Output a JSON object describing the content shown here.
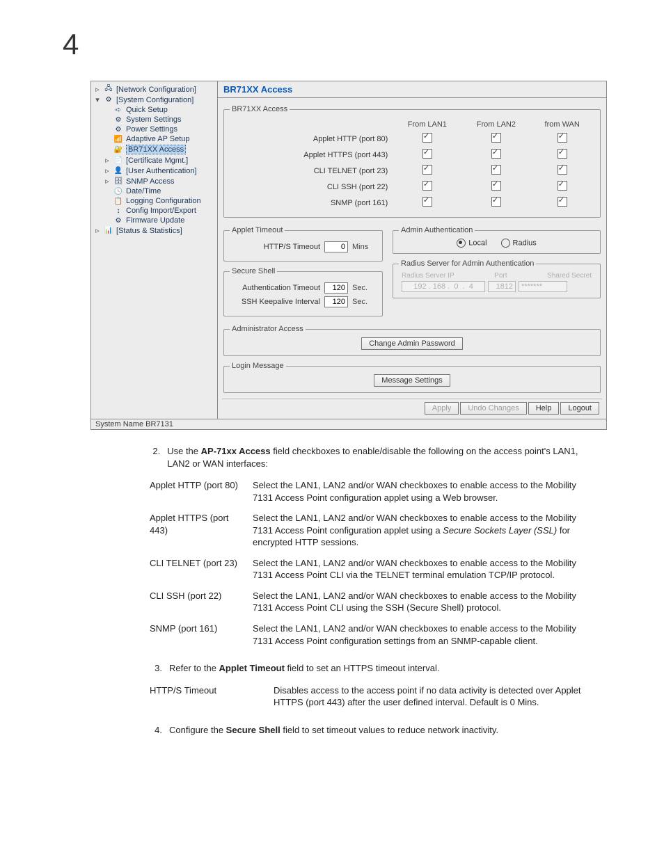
{
  "page_number": "4",
  "screenshot": {
    "tree": {
      "network_config": "[Network Configuration]",
      "system_config": "[System Configuration]",
      "quick_setup": "Quick Setup",
      "system_settings": "System Settings",
      "power_settings": "Power Settings",
      "adaptive_ap_setup": "Adaptive AP Setup",
      "br71xx_access": "BR71XX Access",
      "certificate_mgmt": "[Certificate Mgmt.]",
      "user_auth": "[User Authentication]",
      "snmp_access": "SNMP Access",
      "date_time": "Date/Time",
      "logging_config": "Logging Configuration",
      "config_import_export": "Config Import/Export",
      "firmware_update": "Firmware Update",
      "status_stats": "[Status & Statistics]"
    },
    "content": {
      "title": "BR71XX Access",
      "access_legend": "BR71XX Access",
      "access_cols": {
        "lan1": "From LAN1",
        "lan2": "From LAN2",
        "wan": "from WAN"
      },
      "access_rows": {
        "http": "Applet HTTP (port 80)",
        "https": "Applet HTTPS (port 443)",
        "telnet": "CLI TELNET (port 23)",
        "ssh": "CLI SSH (port 22)",
        "snmp": "SNMP (port 161)"
      },
      "applet_timeout_legend": "Applet Timeout",
      "https_timeout_label": "HTTP/S Timeout",
      "https_timeout_value": "0",
      "https_timeout_unit": "Mins",
      "secure_shell_legend": "Secure Shell",
      "auth_timeout_label": "Authentication Timeout",
      "auth_timeout_value": "120",
      "auth_timeout_unit": "Sec.",
      "ssh_keepalive_label": "SSH Keepalive Interval",
      "ssh_keepalive_value": "120",
      "ssh_keepalive_unit": "Sec.",
      "admin_auth_legend": "Admin Authentication",
      "admin_auth_local": "Local",
      "admin_auth_radius": "Radius",
      "radius_legend": "Radius Server for Admin Authentication",
      "radius_server_ip": "Radius Server IP",
      "radius_port": "Port",
      "radius_secret": "Shared Secret",
      "radius_ip_value": "192 . 168 .  0  .  4",
      "radius_port_value": "1812",
      "radius_secret_value": "*******",
      "admin_access_legend": "Administrator Access",
      "change_admin_pw": "Change Admin Password",
      "login_msg_legend": "Login Message",
      "msg_settings": "Message Settings",
      "btn_apply": "Apply",
      "btn_undo": "Undo Changes",
      "btn_help": "Help",
      "btn_logout": "Logout"
    },
    "status_bar": "System Name BR7131"
  },
  "doc": {
    "step2_pre": "Use the ",
    "step2_bold": "AP-71xx Access",
    "step2_post": " field checkboxes to enable/disable the following on the access point's LAN1, LAN2 or WAN interfaces:",
    "table1": {
      "r1_k": "Applet HTTP (port 80)",
      "r1_v": "Select the LAN1, LAN2 and/or WAN checkboxes to enable access to the Mobility 7131 Access Point configuration applet using a Web browser.",
      "r2_k": "Applet HTTPS (port 443)",
      "r2_v_pre": "Select the LAN1, LAN2 and/or WAN checkboxes to enable access to the Mobility 7131 Access Point configuration applet using a ",
      "r2_v_italic": "Secure Sockets Layer (SSL)",
      "r2_v_post": " for encrypted HTTP sessions.",
      "r3_k": "CLI TELNET (port 23)",
      "r3_v": "Select the LAN1, LAN2 and/or WAN checkboxes to enable access to the Mobility 7131 Access Point CLI via the TELNET terminal emulation TCP/IP protocol.",
      "r4_k": "CLI SSH (port 22)",
      "r4_v": "Select the LAN1, LAN2 and/or WAN checkboxes to enable access to the Mobility 7131 Access Point CLI using the SSH (Secure Shell) protocol.",
      "r5_k": "SNMP (port 161)",
      "r5_v": "Select the LAN1, LAN2 and/or WAN checkboxes to enable access to the Mobility 7131 Access Point configuration settings from an SNMP-capable client."
    },
    "step3_pre": "Refer to the ",
    "step3_bold": "Applet Timeout",
    "step3_post": " field to set an HTTPS timeout interval.",
    "table2": {
      "r1_k": "HTTP/S Timeout",
      "r1_v": "Disables access to the access point if no data activity is detected over Applet HTTPS (port 443) after the user defined interval. Default is 0 Mins."
    },
    "step4_pre": "Configure the ",
    "step4_bold": "Secure Shell",
    "step4_post": " field to set timeout values to reduce network inactivity."
  }
}
